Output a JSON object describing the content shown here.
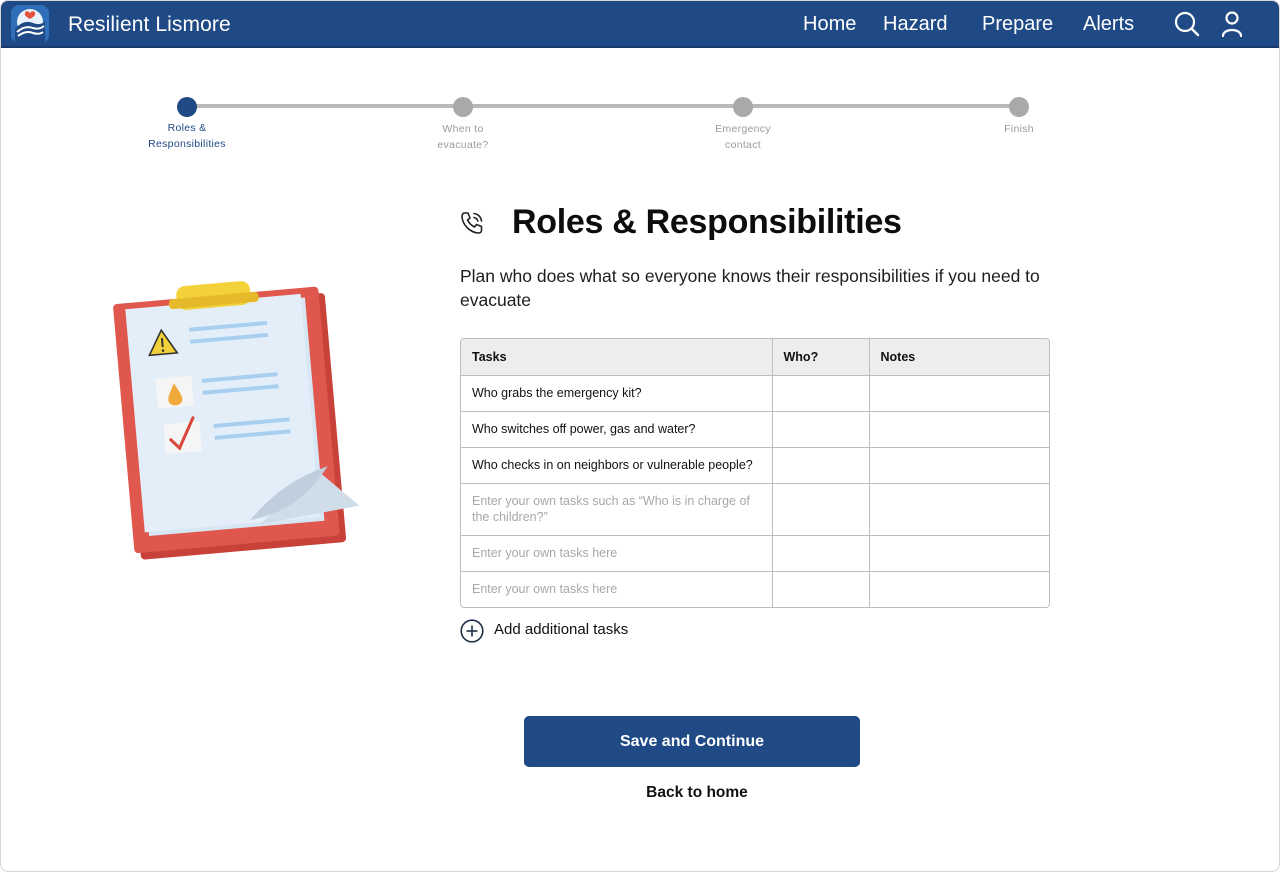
{
  "header": {
    "brand": "Resilient Lismore",
    "nav": [
      "Home",
      "Hazard",
      "Prepare",
      "Alerts"
    ],
    "icons": [
      "search-icon",
      "user-icon"
    ],
    "brand_color": "#1f4a85"
  },
  "stepper": {
    "steps": [
      {
        "line1": "Roles &",
        "line2": "Responsibilities",
        "active": true
      },
      {
        "line1": "When to",
        "line2": "evacuate?",
        "active": false
      },
      {
        "line1": "Emergency",
        "line2": "contact",
        "active": false
      },
      {
        "line1": "Finish",
        "line2": "",
        "active": false
      }
    ],
    "active_color": "#1f4a85",
    "inactive_color": "#a9a9a9"
  },
  "main": {
    "title": "Roles & Responsibilities",
    "title_icon": "phone-call-icon",
    "description": "Plan who does what so everyone knows their responsibilities if you need to evacuate",
    "table": {
      "headers": [
        "Tasks",
        "Who?",
        "Notes"
      ],
      "rows": [
        {
          "task": "Who grabs the emergency kit?",
          "who": "",
          "notes": ""
        },
        {
          "task": "Who switches off power, gas and water?",
          "who": "",
          "notes": ""
        },
        {
          "task": "Who checks in on neighbors or vulnerable people?",
          "who": "",
          "notes": ""
        }
      ],
      "placeholder_rows": [
        "Enter your own tasks such as “Who is in charge of the children?”",
        "Enter your own tasks here",
        "Enter your own tasks here"
      ]
    },
    "add_tasks_label": "Add additional tasks",
    "save_button": "Save and Continue",
    "back_link": "Back to home"
  }
}
